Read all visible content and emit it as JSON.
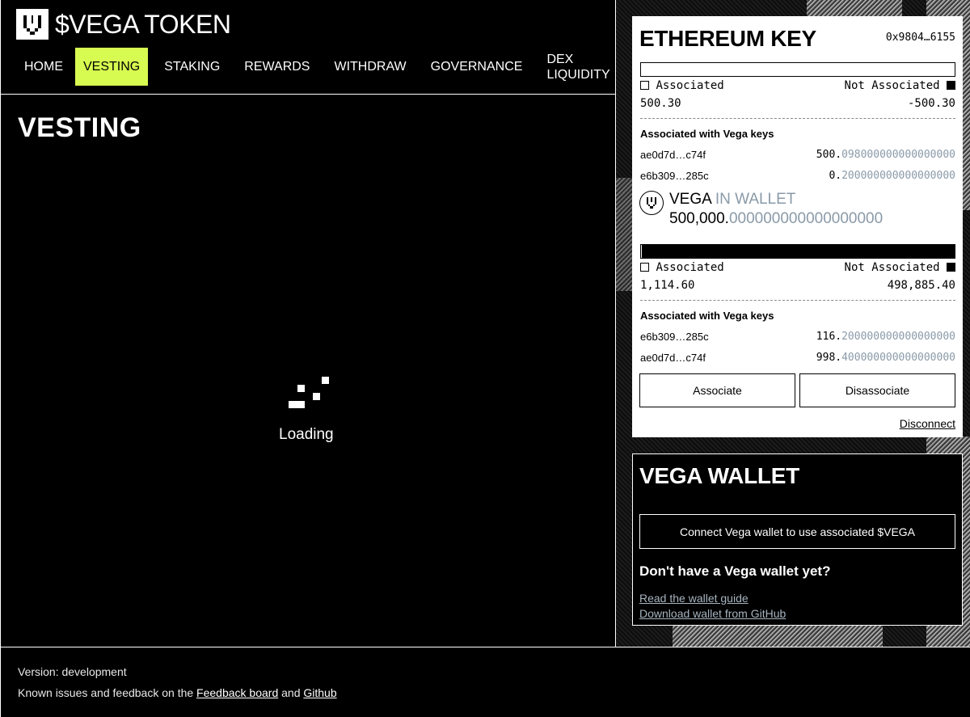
{
  "app": {
    "title": "$VEGA TOKEN"
  },
  "nav": {
    "items": [
      {
        "label": "HOME"
      },
      {
        "label": "VESTING",
        "active": true
      },
      {
        "label": "STAKING"
      },
      {
        "label": "REWARDS"
      },
      {
        "label": "WITHDRAW"
      },
      {
        "label": "GOVERNANCE"
      },
      {
        "label_line1": "DEX",
        "label_line2": "LIQUIDITY"
      }
    ]
  },
  "page": {
    "title": "VESTING",
    "loading_text": "Loading"
  },
  "ethereum": {
    "title": "ETHEREUM KEY",
    "address": "0x9804…6155",
    "section1": {
      "legend_associated": "Associated",
      "legend_not_associated": "Not Associated",
      "associated_value": "500.30",
      "not_associated_value": "-500.30",
      "associated_fraction": 0.0,
      "subhead": "Associated with Vega keys",
      "keys": [
        {
          "key": "ae0d7d…c74f",
          "int": "500.",
          "dec": "098000000000000000"
        },
        {
          "key": "e6b309…285c",
          "int": "0.",
          "dec": "200000000000000000"
        }
      ]
    },
    "wallet": {
      "token": "VEGA",
      "location": "IN WALLET",
      "balance_int": "500,000.",
      "balance_dec": "000000000000000000"
    },
    "section2": {
      "legend_associated": "Associated",
      "legend_not_associated": "Not Associated",
      "associated_value": "1,114.60",
      "not_associated_value": "498,885.40",
      "associated_fraction": 0.0022,
      "subhead": "Associated with Vega keys",
      "keys": [
        {
          "key": "e6b309…285c",
          "int": "116.",
          "dec": "200000000000000000"
        },
        {
          "key": "ae0d7d…c74f",
          "int": "998.",
          "dec": "400000000000000000"
        }
      ]
    },
    "associate_label": "Associate",
    "disassociate_label": "Disassociate",
    "disconnect_label": "Disconnect"
  },
  "vega_wallet": {
    "title": "VEGA WALLET",
    "connect_label": "Connect Vega wallet to use associated $VEGA",
    "question": "Don't have a Vega wallet yet?",
    "link_guide": "Read the wallet guide",
    "link_download": "Download wallet from GitHub"
  },
  "footer": {
    "version": "Version: development",
    "issues_prefix": "Known issues and feedback on the",
    "link_feedback": "Feedback board",
    "and_text": "and",
    "link_github": "Github"
  },
  "colors": {
    "accent": "#d7fb50",
    "muted": "#8a9aa8"
  }
}
